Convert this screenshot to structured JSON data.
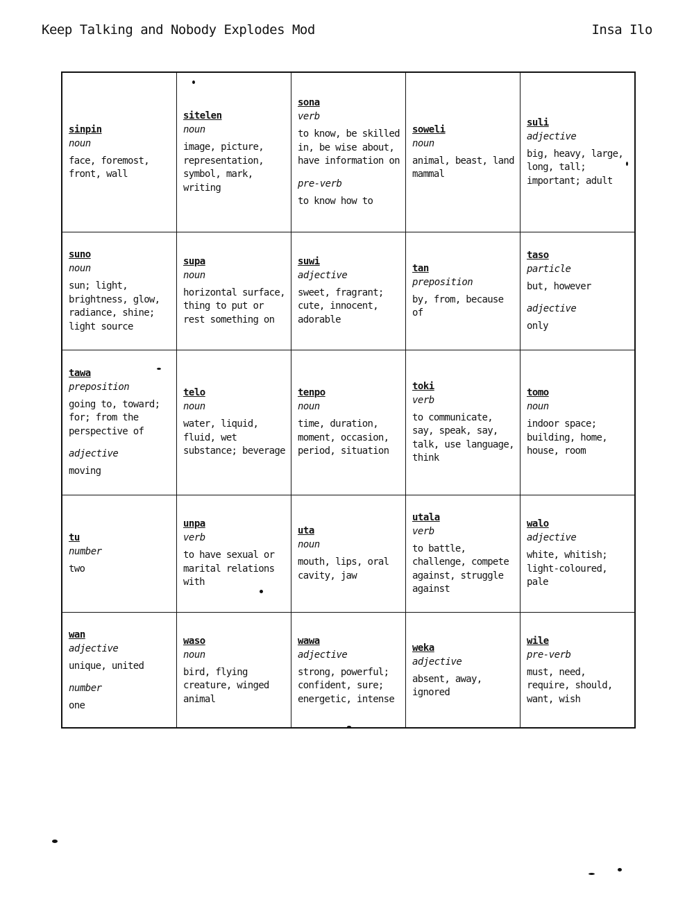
{
  "header": {
    "title": "Keep Talking and Nobody Explodes Mod",
    "module": "Insa Ilo"
  },
  "grid": [
    [
      {
        "word": "sinpin",
        "senses": [
          {
            "pos": "noun",
            "def": "face, foremost, front, wall"
          }
        ]
      },
      {
        "word": "sitelen",
        "senses": [
          {
            "pos": "noun",
            "def": "image, picture, representation, symbol, mark, writing"
          }
        ]
      },
      {
        "word": "sona",
        "senses": [
          {
            "pos": "verb",
            "def": "to know, be skilled in, be wise about, have information on"
          },
          {
            "pos": "pre-verb",
            "def": "to know how to"
          }
        ]
      },
      {
        "word": "soweli",
        "senses": [
          {
            "pos": "noun",
            "def": "animal, beast, land mammal"
          }
        ]
      },
      {
        "word": "suli",
        "senses": [
          {
            "pos": "adjective",
            "def": "big, heavy, large, long, tall; important; adult"
          }
        ]
      }
    ],
    [
      {
        "word": "suno",
        "senses": [
          {
            "pos": "noun",
            "def": "sun; light, brightness, glow, radiance, shine; light source"
          }
        ]
      },
      {
        "word": "supa",
        "senses": [
          {
            "pos": "noun",
            "def": "horizontal surface, thing to put or rest something on"
          }
        ]
      },
      {
        "word": "suwi",
        "senses": [
          {
            "pos": "adjective",
            "def": "sweet, fragrant; cute, innocent, adorable"
          }
        ]
      },
      {
        "word": "tan",
        "senses": [
          {
            "pos": "preposition",
            "def": "by, from, because of"
          }
        ]
      },
      {
        "word": "taso",
        "senses": [
          {
            "pos": "particle",
            "def": "but, however"
          },
          {
            "pos": "adjective",
            "def": "only"
          }
        ]
      }
    ],
    [
      {
        "word": "tawa",
        "senses": [
          {
            "pos": "preposition",
            "def": "going to, toward; for; from the perspective of"
          },
          {
            "pos": "adjective",
            "def": "moving"
          }
        ]
      },
      {
        "word": "telo",
        "senses": [
          {
            "pos": "noun",
            "def": "water, liquid, fluid, wet substance; beverage"
          }
        ]
      },
      {
        "word": "tenpo",
        "senses": [
          {
            "pos": "noun",
            "def": "time, duration, moment, occasion, period, situation"
          }
        ]
      },
      {
        "word": "toki",
        "senses": [
          {
            "pos": "verb",
            "def": "to communicate, say, speak, say, talk, use language, think"
          }
        ]
      },
      {
        "word": "tomo",
        "senses": [
          {
            "pos": "noun",
            "def": "indoor space; building, home, house, room"
          }
        ]
      }
    ],
    [
      {
        "word": "tu",
        "senses": [
          {
            "pos": "number",
            "def": "two"
          }
        ]
      },
      {
        "word": "unpa",
        "senses": [
          {
            "pos": "verb",
            "def": "to have sexual or marital relations with"
          }
        ]
      },
      {
        "word": "uta",
        "senses": [
          {
            "pos": "noun",
            "def": "mouth, lips, oral cavity, jaw"
          }
        ]
      },
      {
        "word": "utala",
        "senses": [
          {
            "pos": "verb",
            "def": "to battle, challenge, compete against, struggle against"
          }
        ]
      },
      {
        "word": "walo",
        "senses": [
          {
            "pos": "adjective",
            "def": "white, whitish; light-coloured, pale"
          }
        ]
      }
    ],
    [
      {
        "word": "wan",
        "senses": [
          {
            "pos": "adjective",
            "def": "unique, united"
          },
          {
            "pos": "number",
            "def": "one"
          }
        ]
      },
      {
        "word": "waso",
        "senses": [
          {
            "pos": "noun",
            "def": "bird, flying creature, winged animal"
          }
        ]
      },
      {
        "word": "wawa",
        "senses": [
          {
            "pos": "adjective",
            "def": "strong, powerful; confident, sure; energetic, intense"
          }
        ]
      },
      {
        "word": "weka",
        "senses": [
          {
            "pos": "adjective",
            "def": "absent, away, ignored"
          }
        ]
      },
      {
        "word": "wile",
        "senses": [
          {
            "pos": "pre-verb",
            "def": "must, need, require, should, want, wish"
          }
        ]
      }
    ]
  ]
}
